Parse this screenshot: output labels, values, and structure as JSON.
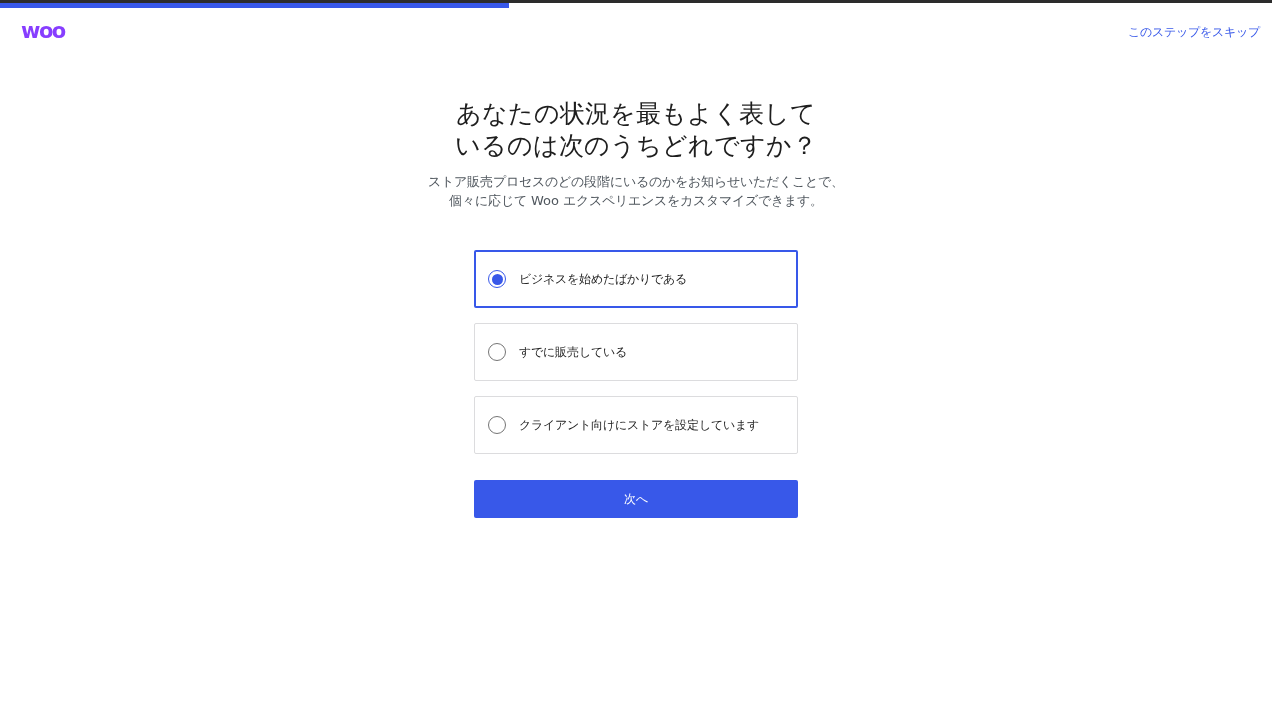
{
  "progress": {
    "level": 0.4
  },
  "header": {
    "logo": "woo",
    "skip_link": "このステップをスキップ"
  },
  "question": {
    "title": "あなたの状況を最もよく表しているのは次のうちどれですか？",
    "description": "ストア販売プロセスのどの段階にいるのかをお知らせいただくことで、個々に応じて Woo エクスペリエンスをカスタマイズできます。"
  },
  "options": [
    {
      "label": "ビジネスを始めたばかりである",
      "selected": true
    },
    {
      "label": "すでに販売している",
      "selected": false
    },
    {
      "label": "クライアント向けにストアを設定しています",
      "selected": false
    }
  ],
  "next_button": "次へ"
}
